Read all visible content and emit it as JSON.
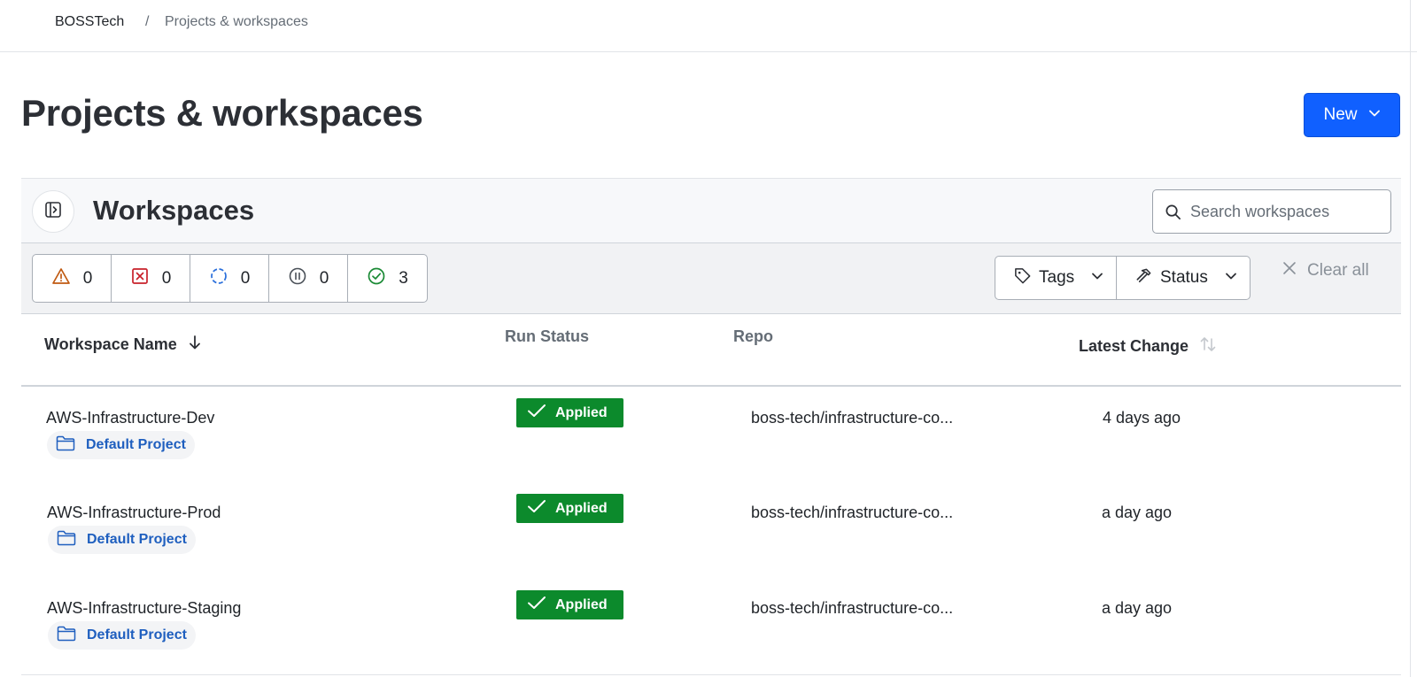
{
  "breadcrumb": {
    "org": "BOSSTech",
    "separator": "/",
    "page": "Projects & workspaces"
  },
  "page": {
    "title": "Projects & workspaces"
  },
  "new_button": {
    "label": "New"
  },
  "workspaces_panel": {
    "title": "Workspaces",
    "search_placeholder": "Search workspaces"
  },
  "status_filters": [
    {
      "icon": "warning-icon",
      "count": "0"
    },
    {
      "icon": "error-icon",
      "count": "0"
    },
    {
      "icon": "running-icon",
      "count": "0"
    },
    {
      "icon": "paused-icon",
      "count": "0"
    },
    {
      "icon": "success-icon",
      "count": "3"
    }
  ],
  "filters": {
    "tags_label": "Tags",
    "status_label": "Status",
    "clear_all_label": "Clear all"
  },
  "table": {
    "columns": {
      "name": "Workspace Name",
      "run_status": "Run Status",
      "repo": "Repo",
      "latest_change": "Latest Change"
    },
    "rows": [
      {
        "name": "AWS-Infrastructure-Dev",
        "project": "Default Project",
        "run_status": "Applied",
        "repo": "boss-tech/infrastructure-co...",
        "latest_change": "4 days ago"
      },
      {
        "name": "AWS-Infrastructure-Prod",
        "project": "Default Project",
        "run_status": "Applied",
        "repo": "boss-tech/infrastructure-co...",
        "latest_change": "a day ago"
      },
      {
        "name": "AWS-Infrastructure-Staging",
        "project": "Default Project",
        "run_status": "Applied",
        "repo": "boss-tech/infrastructure-co...",
        "latest_change": "a day ago"
      }
    ]
  },
  "colors": {
    "primary": "#1060ff",
    "applied": "#0c8a2c",
    "project_link": "#1f5fbf"
  }
}
